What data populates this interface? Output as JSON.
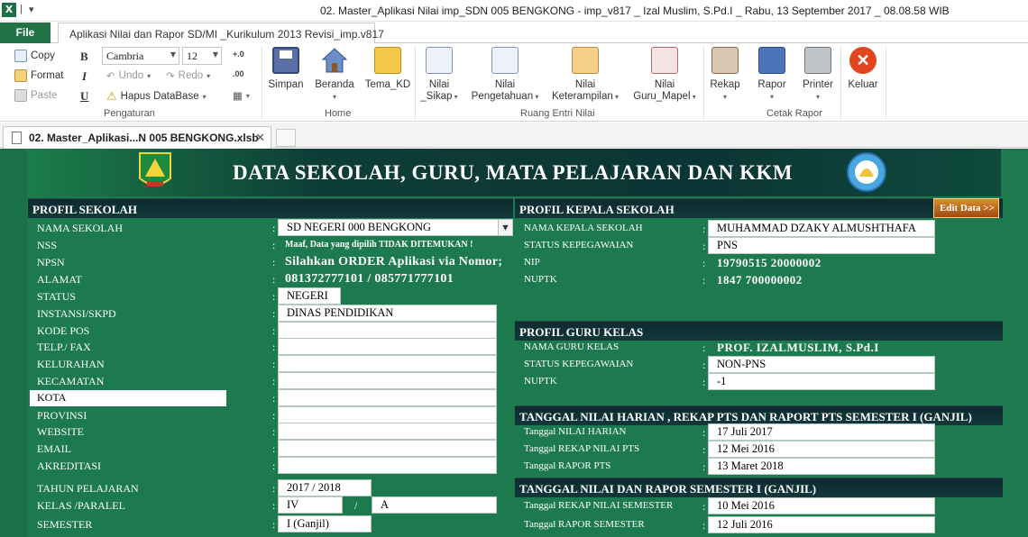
{
  "titlebar": {
    "title": "02. Master_Aplikasi Nilai imp_SDN 005 BENGKONG  -  imp_v817 _ Izal Muslim, S.Pd.I _ Rabu, 13 September 2017 _ 08.08.58  WIB"
  },
  "tabs": {
    "file": "File",
    "app": "Aplikasi Nilai dan Rapor SD/MI _Kurikulum 2013 Revisi_imp.v817"
  },
  "ribbon": {
    "copy": "Copy",
    "format": "Format",
    "paste": "Paste",
    "font_name": "Cambria",
    "font_size": "12",
    "undo": "Undo",
    "redo": "Redo",
    "hapus": "Hapus DataBase",
    "bold": "B",
    "italic": "I",
    "underline": "U",
    "group_pengaturan": "Pengaturan",
    "simpan": "Simpan",
    "beranda": "Beranda",
    "tema": "Tema_KD",
    "group_home": "Home",
    "nilai_sikap": [
      "Nilai",
      "_Sikap"
    ],
    "nilai_pengetahuan": [
      "Nilai",
      "Pengetahuan"
    ],
    "nilai_keterampilan": [
      "Nilai",
      "Keterampilan"
    ],
    "nilai_guru": [
      "Nilai",
      "Guru_Mapel"
    ],
    "group_ruang": "Ruang Entri Nilai",
    "rekap": "Rekap",
    "rapor": "Rapor",
    "printer": "Printer",
    "group_cetak": "Cetak Rapor",
    "keluar": "Keluar"
  },
  "doc": {
    "tab": "02. Master_Aplikasi...N 005 BENGKONG.xlsb",
    "close": "✕"
  },
  "banner": {
    "title": "DATA SEKOLAH, GURU, MATA PELAJARAN DAN KKM"
  },
  "profil_sekolah": {
    "header": "PROFIL SEKOLAH",
    "rows": [
      {
        "label": "NAMA SEKOLAH",
        "value": "SD NEGERI 000 BENGKONG"
      },
      {
        "label": "NSS",
        "value": "Maaf, Data yang dipilih TIDAK DITEMUKAN !"
      },
      {
        "label": "NPSN",
        "value": "Silahkan ORDER Aplikasi via Nomor;"
      },
      {
        "label": "ALAMAT",
        "value": "081372777101 / 085771777101"
      },
      {
        "label": "STATUS",
        "value": "NEGERI"
      },
      {
        "label": "INSTANSI/SKPD",
        "value": "DINAS PENDIDIKAN"
      },
      {
        "label": "KODE POS",
        "value": ""
      },
      {
        "label": "TELP./ FAX",
        "value": ""
      },
      {
        "label": "KELURAHAN",
        "value": ""
      },
      {
        "label": "KECAMATAN",
        "value": ""
      },
      {
        "label": "KOTA",
        "value": ""
      },
      {
        "label": "PROVINSI",
        "value": ""
      },
      {
        "label": "WEBSITE",
        "value": ""
      },
      {
        "label": "EMAIL",
        "value": ""
      },
      {
        "label": "AKREDITASI",
        "value": ""
      }
    ],
    "tahun_label": "TAHUN PELAJARAN",
    "tahun_value": "2017 / 2018",
    "kelas_label": "KELAS /PARALEL",
    "kelas_value": "IV",
    "kelas_sep": "/",
    "paralel_value": "A",
    "semester_label": "SEMESTER",
    "semester_value": "I (Ganjil)"
  },
  "kepala": {
    "header": "PROFIL KEPALA SEKOLAH",
    "edit": "Edit Data >>",
    "rows": [
      {
        "label": "NAMA KEPALA SEKOLAH",
        "value": "MUHAMMAD DZAKY ALMUSHTHAFA"
      },
      {
        "label": "STATUS KEPEGAWAIAN",
        "value": "PNS"
      },
      {
        "label": "NIP",
        "value": "19790515 20000002"
      },
      {
        "label": "NUPTK",
        "value": "1847 700000002"
      }
    ]
  },
  "guru": {
    "header": "PROFIL GURU KELAS",
    "rows": [
      {
        "label": "NAMA GURU KELAS",
        "value": "PROF. IZALMUSLIM, S.Pd.I"
      },
      {
        "label": "STATUS KEPEGAWAIAN",
        "value": "NON-PNS"
      },
      {
        "label": "NUPTK",
        "value": "-1"
      }
    ]
  },
  "tanggal_pts": {
    "header": "TANGGAL NILAI HARIAN , REKAP PTS DAN RAPORT  PTS  SEMESTER I (GANJIL)",
    "rows": [
      {
        "label": "Tanggal NILAI HARIAN",
        "value": "17 Juli 2017"
      },
      {
        "label": "Tanggal REKAP NILAI PTS",
        "value": "12 Mei 2016"
      },
      {
        "label": "Tanggal RAPOR PTS",
        "value": "13 Maret 2018"
      }
    ]
  },
  "tanggal_sem": {
    "header": "TANGGAL NILAI DAN RAPOR SEMESTER I (GANJIL)",
    "rows": [
      {
        "label": "Tanggal REKAP NILAI SEMESTER",
        "value": "10 Mei 2016"
      },
      {
        "label": "Tanggal RAPOR SEMESTER",
        "value": "12 Juli 2016"
      }
    ]
  },
  "colon": ":"
}
